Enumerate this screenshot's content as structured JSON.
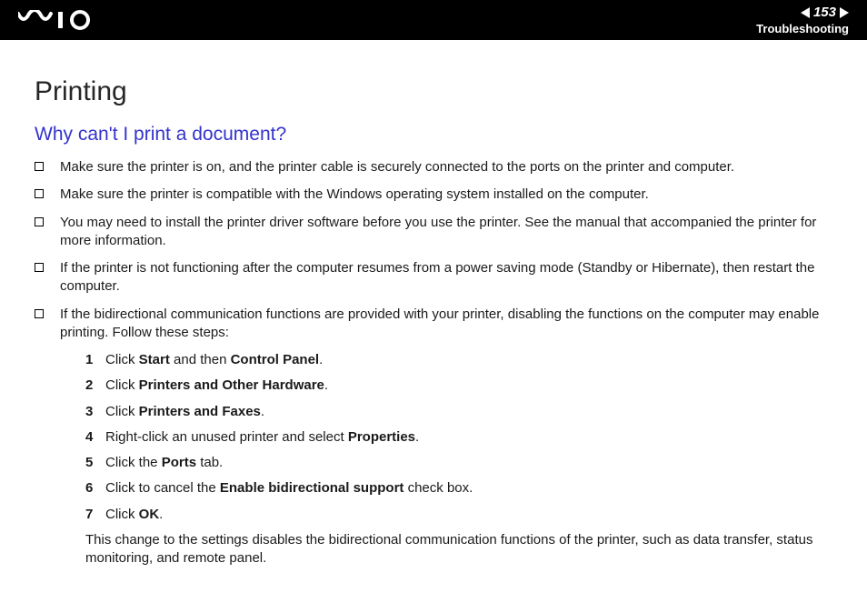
{
  "header": {
    "page_number": "153",
    "section": "Troubleshooting"
  },
  "content": {
    "title": "Printing",
    "subtitle": "Why can't I print a document?",
    "bullets": [
      "Make sure the printer is on, and the printer cable is securely connected to the ports on the printer and computer.",
      "Make sure the printer is compatible with the Windows operating system installed on the computer.",
      "You may need to install the printer driver software before you use the printer. See the manual that accompanied the printer for more information.",
      "If the printer is not functioning after the computer resumes from a power saving mode (Standby or Hibernate), then restart the computer.",
      "If the bidirectional communication functions are provided with your printer, disabling the functions on the computer may enable printing. Follow these steps:"
    ],
    "steps": [
      {
        "n": "1",
        "pre": "Click ",
        "b1": "Start",
        "mid": " and then ",
        "b2": "Control Panel",
        "post": "."
      },
      {
        "n": "2",
        "pre": "Click ",
        "b1": "Printers and Other Hardware",
        "mid": "",
        "b2": "",
        "post": "."
      },
      {
        "n": "3",
        "pre": "Click ",
        "b1": "Printers and Faxes",
        "mid": "",
        "b2": "",
        "post": "."
      },
      {
        "n": "4",
        "pre": "Right-click an unused printer and select ",
        "b1": "Properties",
        "mid": "",
        "b2": "",
        "post": "."
      },
      {
        "n": "5",
        "pre": "Click the ",
        "b1": "Ports",
        "mid": "",
        "b2": "",
        "post": " tab."
      },
      {
        "n": "6",
        "pre": "Click to cancel the ",
        "b1": "Enable bidirectional support",
        "mid": "",
        "b2": "",
        "post": " check box."
      },
      {
        "n": "7",
        "pre": "Click ",
        "b1": "OK",
        "mid": "",
        "b2": "",
        "post": "."
      }
    ],
    "after_steps": "This change to the settings disables the bidirectional communication functions of the printer, such as data transfer, status monitoring, and remote panel."
  }
}
